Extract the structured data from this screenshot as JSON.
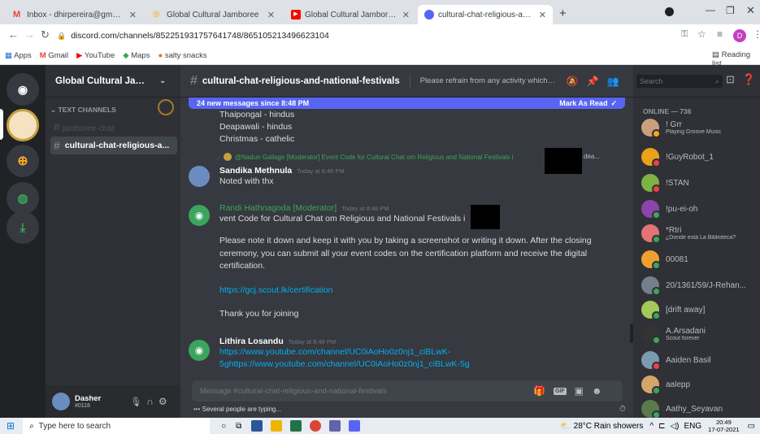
{
  "browser": {
    "tabs": [
      {
        "title": "Inbox - dhirpereira@gmail.com - ",
        "color": "#ea4335",
        "glyph": "M"
      },
      {
        "title": "Global Cultural Jamboree",
        "color": "#f4a300",
        "glyph": "◎"
      },
      {
        "title": "Global Cultural Jamboree - Webi",
        "color": "#ff0000",
        "glyph": "▶"
      },
      {
        "title": "cultural-chat-religious-and-natio",
        "color": "#5865f2",
        "glyph": "◉"
      }
    ],
    "new_tab": "+",
    "url": "discord.com/channels/852251931757641748/865105213496623104",
    "bookmarks": [
      "Apps",
      "Gmail",
      "YouTube",
      "Maps",
      "salty snacks"
    ],
    "reading_list": "Reading list",
    "profile_initial": "D"
  },
  "server": {
    "name": "Global Cultural Jambore...",
    "category": "TEXT CHANNELS",
    "channels": [
      "jamboree-chat",
      "cultural-chat-religious-a..."
    ]
  },
  "channel": {
    "name": "cultural-chat-religious-and-national-festivals",
    "topic": "Please refrain from any activity which may ..."
  },
  "search": {
    "placeholder": "Search"
  },
  "banner": {
    "text": "24 new messages since 8:48 PM",
    "action": "Mark As Read"
  },
  "messages": {
    "prev_lines": [
      "Thaipongal - hindus",
      "Deapawali - hindus",
      "Christmas - cathelic"
    ],
    "reply_ref": "@Nadun Gallage [Moderator]  Event Code for Cultural Chat om Religious and National Festivals i",
    "reply_ref_tail": "dea...",
    "m1": {
      "author": "Sandika Methnula",
      "time": "Today at 8:48 PM",
      "text": "Noted with thx"
    },
    "m2": {
      "author": "Randi Hathnagoda [Moderator]",
      "time": "Today at 8:48 PM",
      "line1": "vent Code for Cultural Chat om Religious and National Festivals i",
      "para": "Please note it down and keep it with you by taking a screenshot or writing it down. After the closing ceremony, you can submit all your event codes on the certification platform and receive the digital certification.",
      "link": "https://gcj.scout.lk/certification",
      "thanks": "Thank you for joining"
    },
    "m3": {
      "author": "Lithira Losandu",
      "time": "Today at 8:48 PM",
      "link1": "https://www.youtube.com/channel/UC0iAoHo0z0nj1_ciBLwK-",
      "link2": "5ghttps://www.youtube.com/channel/UC0iAoHo0z0nj1_ciBLwK-5g"
    }
  },
  "composer": {
    "placeholder": "Message #cultural-chat-religious-and-national-festivals",
    "typing": "Several people are typing..."
  },
  "user": {
    "name": "Dasher",
    "tag": "#0118"
  },
  "members": {
    "header": "ONLINE — 736",
    "list": [
      {
        "name": "! Grr",
        "sub": "Playing Groove Music",
        "color": "#c9a07a",
        "status": "#faa61a"
      },
      {
        "name": "!GuyRobot_1",
        "sub": "",
        "color": "#e8a317",
        "status": "#ed4245"
      },
      {
        "name": "!STAN",
        "sub": "",
        "color": "#7cb342",
        "status": "#ed4245"
      },
      {
        "name": "!pu-ei-oh",
        "sub": "",
        "color": "#8e44ad",
        "status": "#3ba55d"
      },
      {
        "name": "*Rtri",
        "sub": "¿Donde está La Biblioteca?",
        "color": "#e57373",
        "status": "#3ba55d"
      },
      {
        "name": "00081",
        "sub": "",
        "color": "#f0a030",
        "status": "#3ba55d"
      },
      {
        "name": "20/1361/59/J-Rehan...",
        "sub": "",
        "color": "#747f8d",
        "status": "#3ba55d"
      },
      {
        "name": "[drift away]",
        "sub": "",
        "color": "#a5c85a",
        "status": "#3ba55d"
      },
      {
        "name": "A.Arsadani",
        "sub": "Scout forever",
        "color": "#333333",
        "status": "#3ba55d"
      },
      {
        "name": "Aaiden Basil",
        "sub": "",
        "color": "#7c9ab0",
        "status": "#ed4245"
      },
      {
        "name": "aalepp",
        "sub": "",
        "color": "#d4a56a",
        "status": "#3ba55d"
      },
      {
        "name": "Aathy_Seyavan",
        "sub": "",
        "color": "#5a7a4a",
        "status": "#3ba55d"
      }
    ]
  },
  "taskbar": {
    "search": "Type here to search",
    "weather": "28°C  Rain showers",
    "lang": "ENG",
    "time": "20:49",
    "date": "17-07-2021"
  },
  "colors": {
    "accent": "#5865f2",
    "link": "#00aff4",
    "moderator": "#3ba55d"
  }
}
